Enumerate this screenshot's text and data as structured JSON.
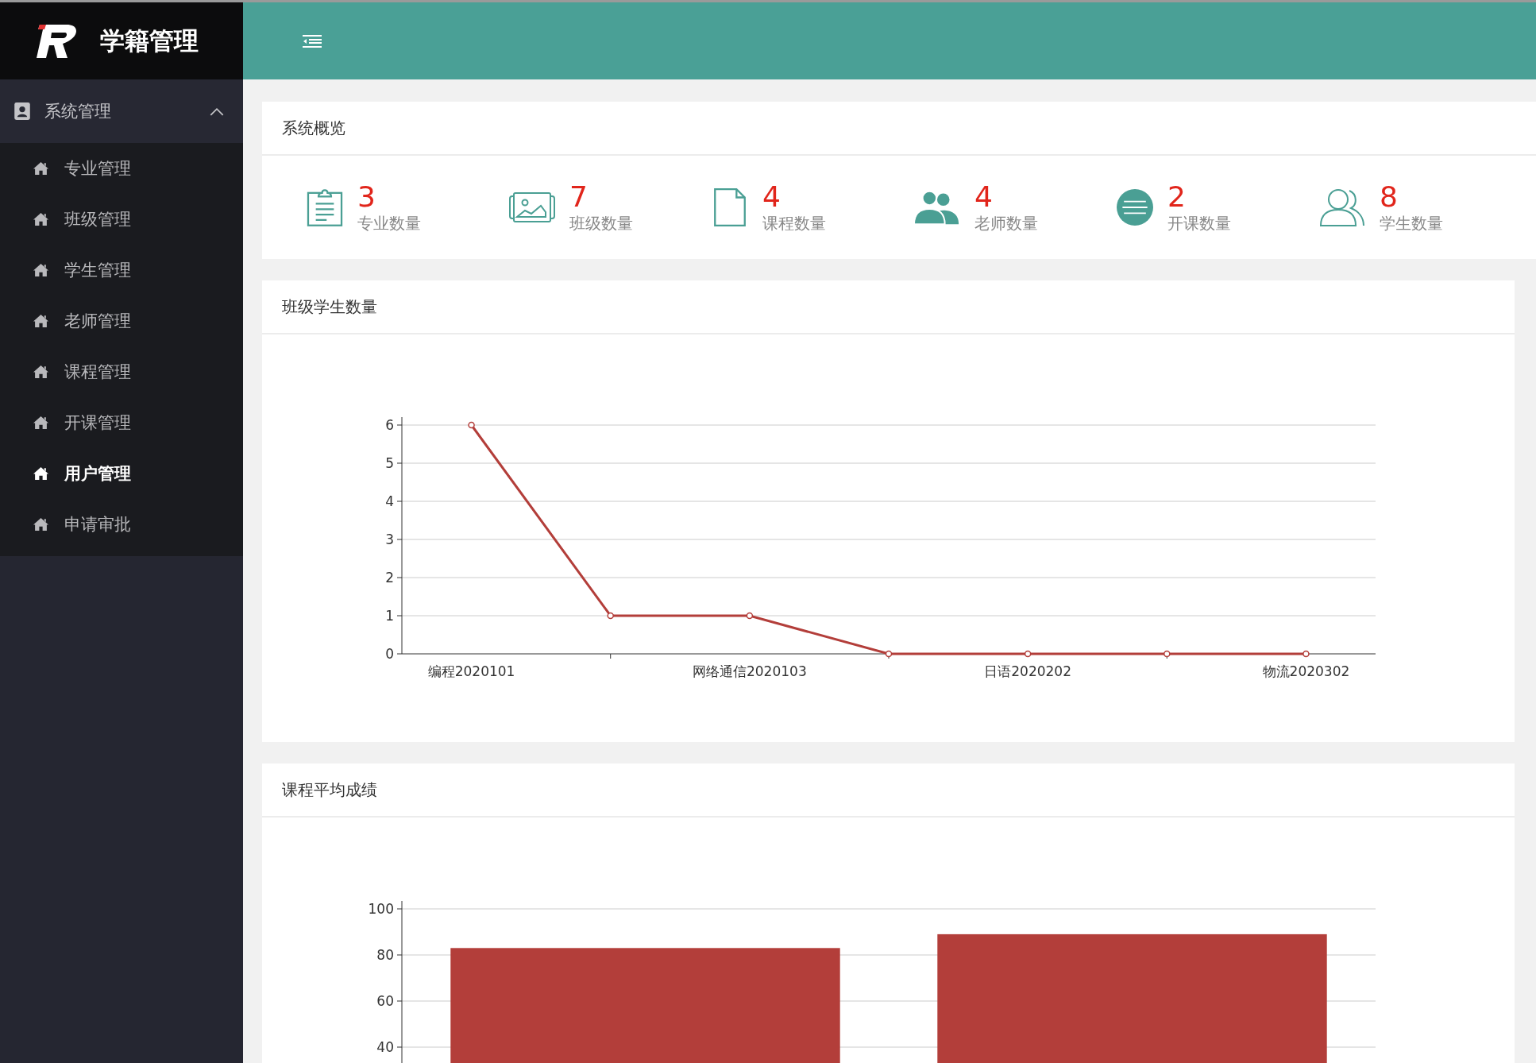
{
  "app": {
    "title": "学籍管理"
  },
  "sidebar": {
    "group": {
      "label": "系统管理",
      "expanded": true
    },
    "items": [
      {
        "label": "专业管理",
        "selected": false
      },
      {
        "label": "班级管理",
        "selected": false
      },
      {
        "label": "学生管理",
        "selected": false
      },
      {
        "label": "老师管理",
        "selected": false
      },
      {
        "label": "课程管理",
        "selected": false
      },
      {
        "label": "开课管理",
        "selected": false
      },
      {
        "label": "用户管理",
        "selected": true
      },
      {
        "label": "申请审批",
        "selected": false
      }
    ]
  },
  "overview": {
    "title": "系统概览",
    "stats": [
      {
        "kind": "clipboard",
        "value": "3",
        "label": "专业数量"
      },
      {
        "kind": "pictures",
        "value": "7",
        "label": "班级数量"
      },
      {
        "kind": "file",
        "value": "4",
        "label": "课程数量"
      },
      {
        "kind": "users",
        "value": "4",
        "label": "老师数量"
      },
      {
        "kind": "list",
        "value": "2",
        "label": "开课数量"
      },
      {
        "kind": "user",
        "value": "8",
        "label": "学生数量"
      }
    ]
  },
  "class_chart": {
    "title": "班级学生数量",
    "chart_data": {
      "type": "line",
      "categories": [
        "编程2020101",
        null,
        "网络通信2020103",
        null,
        "日语2020202",
        null,
        "物流2020302"
      ],
      "series": [
        {
          "color": "#b33e3a",
          "marker": "circle",
          "values": [
            6,
            1,
            1,
            0,
            0,
            0,
            0
          ]
        }
      ],
      "ylim": [
        0,
        6
      ],
      "yticks": [
        0,
        1,
        2,
        3,
        4,
        5,
        6
      ],
      "grid": true
    }
  },
  "course_chart": {
    "title": "课程平均成绩",
    "chart_data": {
      "type": "bar",
      "series": [
        {
          "color": "#b33e3a",
          "values": [
            83,
            89
          ]
        }
      ],
      "ylim": [
        0,
        100
      ],
      "yticks": [
        40,
        60,
        80,
        100
      ],
      "grid": true
    }
  }
}
